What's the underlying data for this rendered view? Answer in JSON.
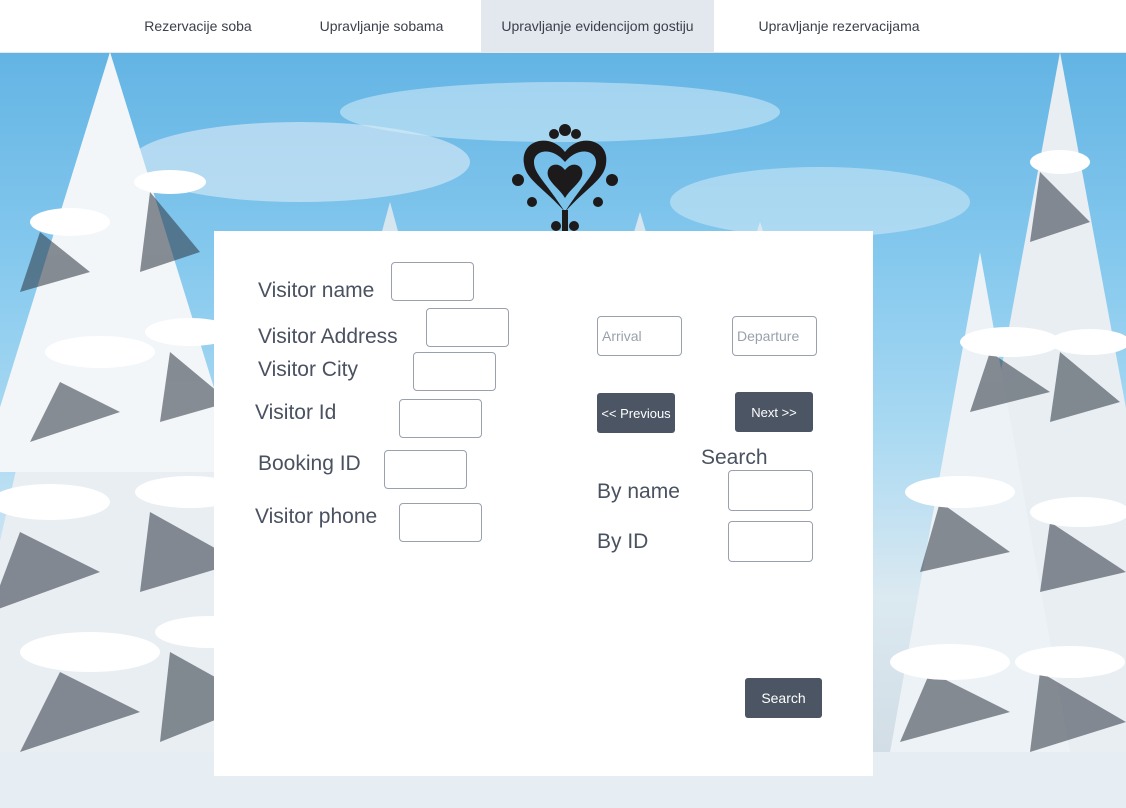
{
  "nav": {
    "items": [
      {
        "label": "Rezervacije soba",
        "active": false
      },
      {
        "label": "Upravljanje sobama",
        "active": false
      },
      {
        "label": "Upravljanje evidencijom gostiju",
        "active": true
      },
      {
        "label": "Upravljanje rezervacijama",
        "active": false
      }
    ]
  },
  "background": {
    "description_icon": "snowy-forest-image"
  },
  "logo": {
    "icon": "ornamental-heart-logo-icon"
  },
  "form": {
    "visitor_name": {
      "label": "Visitor name",
      "value": ""
    },
    "visitor_address": {
      "label": "Visitor Address",
      "value": ""
    },
    "visitor_city": {
      "label": "Visitor City",
      "value": ""
    },
    "visitor_id": {
      "label": "Visitor Id",
      "value": ""
    },
    "booking_id": {
      "label": "Booking ID",
      "value": ""
    },
    "visitor_phone": {
      "label": "Visitor phone",
      "value": ""
    },
    "arrival": {
      "placeholder": "Arrival",
      "value": ""
    },
    "departure": {
      "placeholder": "Departure",
      "value": ""
    },
    "previous_label": "<< Previous",
    "next_label": "Next >>"
  },
  "search": {
    "heading": "Search",
    "by_name_label": "By name",
    "by_id_label": "By ID",
    "by_name_value": "",
    "by_id_value": "",
    "button_label": "Search"
  },
  "colors": {
    "button_bg": "#4b5563",
    "nav_active_bg": "#e3e7ee",
    "text": "#4a5160"
  }
}
